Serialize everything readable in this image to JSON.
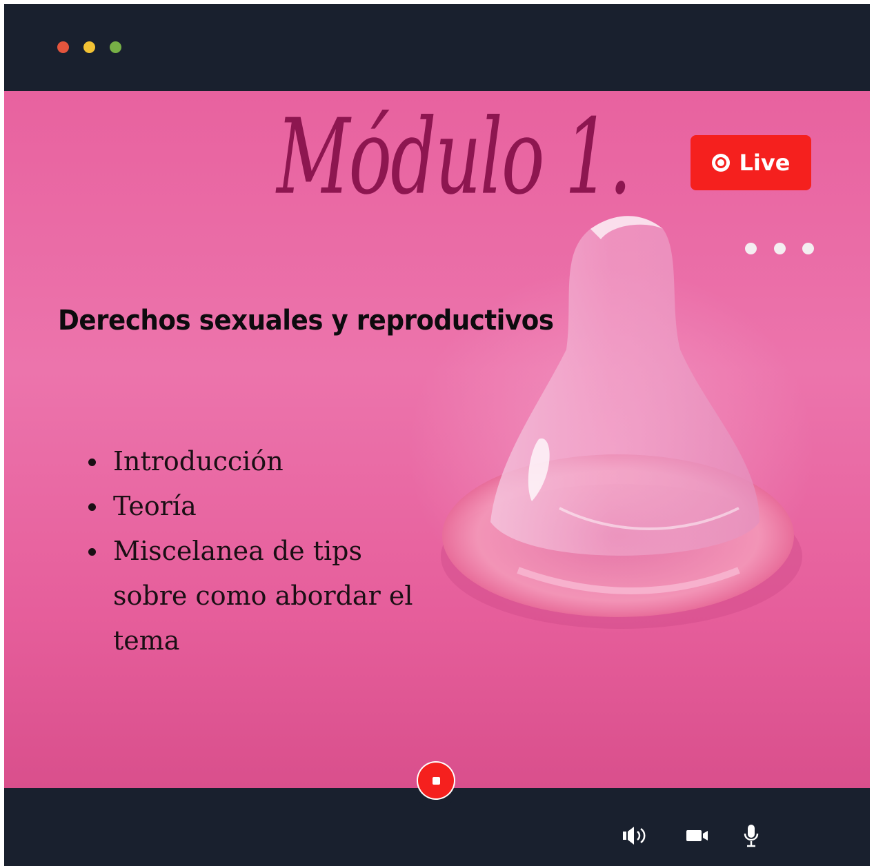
{
  "window": {
    "traffic_lights": [
      "close",
      "minimize",
      "maximize"
    ],
    "colors": {
      "frame": "#19202e",
      "close": "#e4553d",
      "minimize": "#f2c234",
      "maximize": "#77b046"
    }
  },
  "slide": {
    "heading": "Módulo 1.",
    "subtitle": "Derechos sexuales y reproductivos",
    "agenda": [
      "Introducción",
      "Teoría",
      "Miscelanea de tips sobre como abordar el tema"
    ],
    "background_color": "#e8629f",
    "heading_color": "#8d1650"
  },
  "stream": {
    "live_label": "Live",
    "live_color": "#f5201e",
    "more_icon": "more-horizontal-icon"
  },
  "controls": {
    "record_icon": "stop-record-icon",
    "speaker_icon": "speaker-icon",
    "camera_icon": "video-camera-icon",
    "mic_icon": "microphone-icon"
  }
}
